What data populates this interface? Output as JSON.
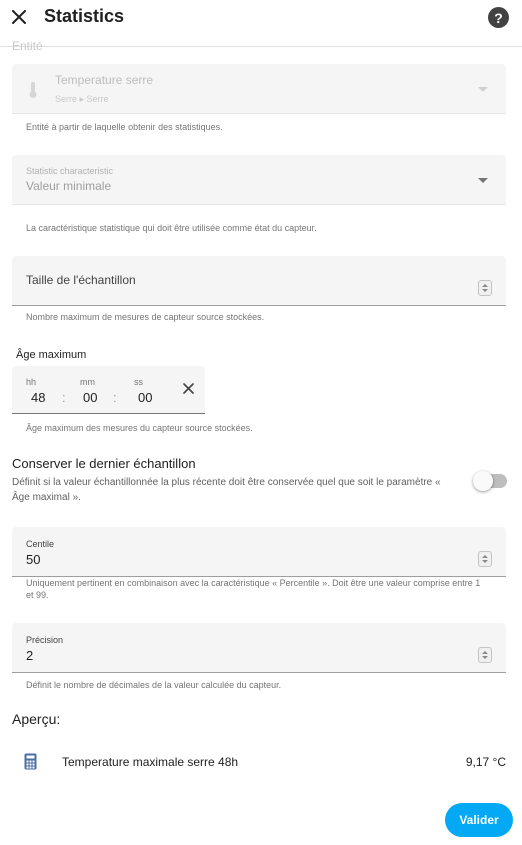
{
  "dialog": {
    "title": "Statistics",
    "close_icon": "close-icon",
    "help_icon": "help-icon",
    "help_glyph": "?"
  },
  "entity": {
    "cut_label": "Entité",
    "name": "Temperature serre",
    "area": "Serre ▸ Serre",
    "icon": "thermometer-icon",
    "helper": "Entité à partir de laquelle obtenir des statistiques."
  },
  "characteristic": {
    "label": "Statistic characteristic",
    "value": "Valeur minimale",
    "helper": "La caractéristique statistique qui doit être utilisée comme état du capteur."
  },
  "sampling": {
    "label": "Taille de l'échantillon",
    "value": "",
    "helper": "Nombre maximum de mesures de capteur source stockées."
  },
  "max_age": {
    "label": "Âge maximum",
    "hh_label": "hh",
    "mm_label": "mm",
    "ss_label": "ss",
    "hh": "48",
    "mm": "00",
    "ss": "00",
    "separator": ":",
    "clear_icon": "clear-icon",
    "helper": "Âge maximum des mesures du capteur source stockées."
  },
  "keep_last": {
    "title": "Conserver le dernier échantillon",
    "description": "Définit si la valeur échantillonnée la plus récente doit être conservée quel que soit le paramètre « Âge maximal ».",
    "enabled": false
  },
  "percentile": {
    "label": "Centile",
    "value": "50",
    "helper": "Uniquement pertinent en combinaison avec la caractéristique « Percentile ». Doit être une valeur comprise entre 1 et 99."
  },
  "precision": {
    "label": "Précision",
    "value": "2",
    "helper": "Définit le nombre de décimales de la valeur calculée du capteur."
  },
  "preview": {
    "title": "Aperçu:",
    "icon": "calculator-icon",
    "name": "Temperature maximale serre 48h",
    "value": "9,17 °C"
  },
  "actions": {
    "submit_label": "Valider"
  },
  "colors": {
    "accent": "#03a9f4",
    "field_bg": "#f5f5f5",
    "helper_text": "#757575"
  }
}
